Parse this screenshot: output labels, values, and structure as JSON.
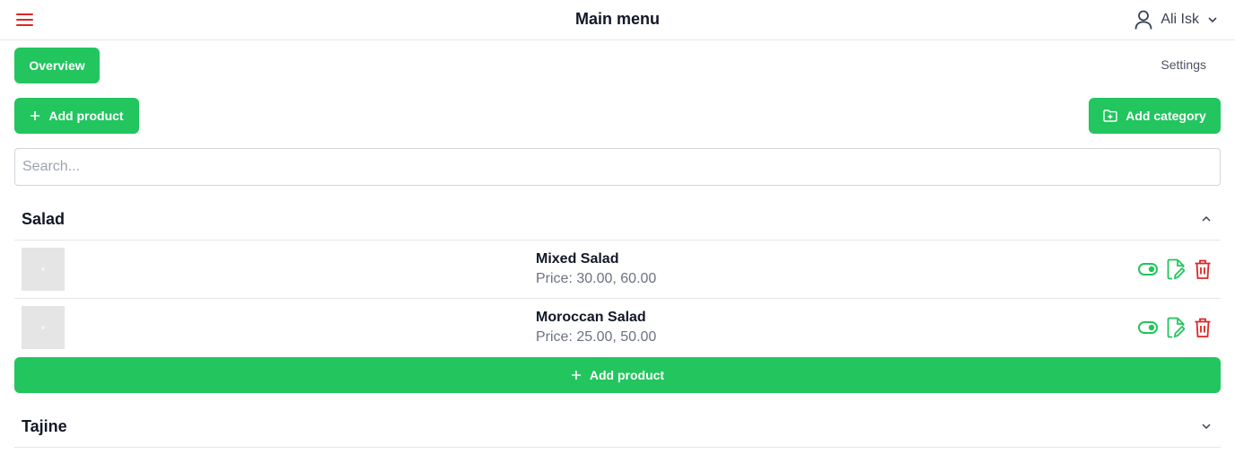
{
  "header": {
    "title": "Main menu",
    "user_name": "Ali Isk",
    "menu_icon": "hamburger-icon",
    "user_icon": "user-icon"
  },
  "nav": {
    "overview_label": "Overview",
    "settings_label": "Settings"
  },
  "toolbar": {
    "add_product_label": "Add product",
    "add_category_label": "Add category"
  },
  "search": {
    "placeholder": "Search...",
    "value": ""
  },
  "categories": [
    {
      "name": "Salad",
      "expanded": true,
      "products": [
        {
          "name": "Mixed Salad",
          "price": "Price: 30.00, 60.00"
        },
        {
          "name": "Moroccan Salad",
          "price": "Price: 25.00, 50.00"
        }
      ],
      "add_product_label": "Add product"
    },
    {
      "name": "Tajine",
      "expanded": false,
      "products": []
    }
  ],
  "colors": {
    "accent": "#22c55e",
    "danger": "#dc2626",
    "border": "#e5e7eb"
  }
}
